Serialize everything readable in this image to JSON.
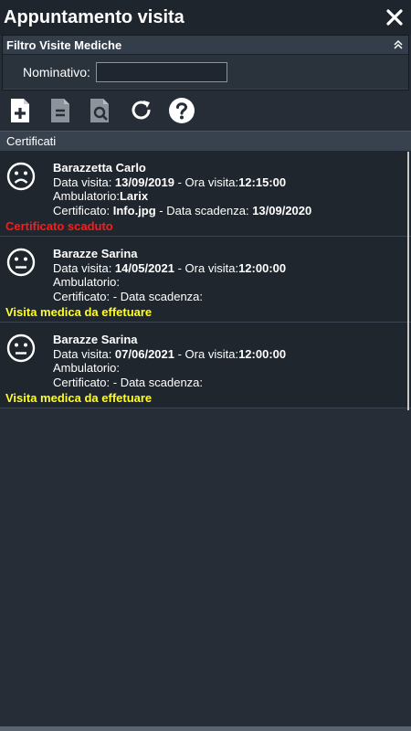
{
  "window": {
    "title": "Appuntamento visita",
    "close_icon": "close-icon"
  },
  "filter": {
    "title": "Filtro Visite Mediche",
    "collapse_icon": "double-chevron-up-icon",
    "nominativo_label": "Nominativo:",
    "nominativo_value": ""
  },
  "toolbar": {
    "icons": [
      "add-document-icon",
      "document-icon",
      "search-document-icon",
      "refresh-icon",
      "help-icon"
    ]
  },
  "list_header": "Certificati",
  "items": [
    {
      "face": "sad-face-icon",
      "name": "Barazzetta Carlo",
      "date_label": "Data visita: ",
      "date": "13/09/2019",
      "time_label": " - Ora visita:",
      "time": "12:15:00",
      "ambulatorio_label": "Ambulatorio:",
      "ambulatorio": "Larix",
      "cert_label": "Certificato: ",
      "cert": "Info.jpg",
      "expiry_label": " - Data scadenza: ",
      "expiry": "13/09/2020",
      "status": "Certificato scaduto",
      "status_color": "#ff1a1a"
    },
    {
      "face": "neutral-face-icon",
      "name": "Barazze Sarina",
      "date_label": "Data visita: ",
      "date": "14/05/2021",
      "time_label": " - Ora visita:",
      "time": "12:00:00",
      "ambulatorio_label": "Ambulatorio:",
      "ambulatorio": "",
      "cert_label": "Certificato: ",
      "cert": "",
      "expiry_label": "- Data scadenza:",
      "expiry": "",
      "status": "Visita medica da effetuare",
      "status_color": "#ffff20"
    },
    {
      "face": "neutral-face-icon",
      "name": "Barazze Sarina",
      "date_label": "Data visita: ",
      "date": "07/06/2021",
      "time_label": " - Ora visita:",
      "time": "12:00:00",
      "ambulatorio_label": "Ambulatorio:",
      "ambulatorio": "",
      "cert_label": "Certificato: ",
      "cert": "",
      "expiry_label": "- Data scadenza:",
      "expiry": "",
      "status": "Visita medica da effetuare",
      "status_color": "#ffff20"
    }
  ]
}
